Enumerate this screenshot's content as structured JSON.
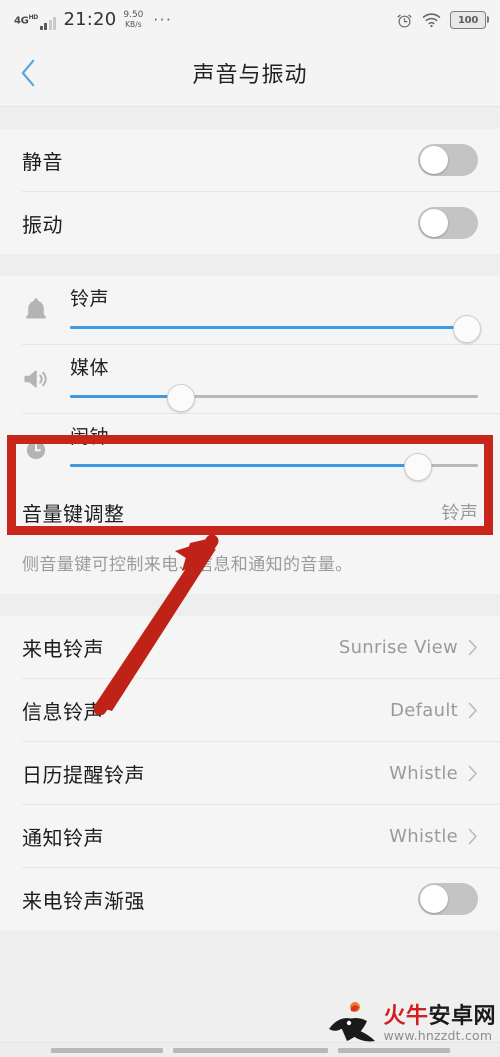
{
  "statusbar": {
    "network_label": "4G",
    "network_sup": "HD",
    "time": "21:20",
    "speed_value": "9.50",
    "speed_unit": "KB/s",
    "overflow": "···",
    "alarm_icon": "alarm-clock-icon",
    "wifi_icon": "wifi-icon",
    "battery_level": "100"
  },
  "header": {
    "back_icon": "chevron-left-icon",
    "title": "声音与振动"
  },
  "toggles": [
    {
      "label": "静音",
      "state": "off",
      "name": "mute"
    },
    {
      "label": "振动",
      "state": "off",
      "name": "vibrate"
    }
  ],
  "sliders": [
    {
      "label": "铃声",
      "icon": "bell-icon",
      "percent": 97,
      "name": "ringtone-volume"
    },
    {
      "label": "媒体",
      "icon": "speaker-icon",
      "percent": 27,
      "name": "media-volume"
    },
    {
      "label": "闹钟",
      "icon": "alarm-clock-icon",
      "percent": 85,
      "name": "alarm-volume"
    }
  ],
  "volume_key": {
    "label": "音量键调整",
    "value": "铃声",
    "description": "侧音量键可控制来电、信息和通知的音量。"
  },
  "ringtone_rows": [
    {
      "label": "来电铃声",
      "value": "Sunrise View",
      "name": "incoming-call-ringtone"
    },
    {
      "label": "信息铃声",
      "value": "Default",
      "name": "message-ringtone"
    },
    {
      "label": "日历提醒铃声",
      "value": "Whistle",
      "name": "calendar-reminder-ringtone"
    },
    {
      "label": "通知铃声",
      "value": "Whistle",
      "name": "notification-ringtone"
    }
  ],
  "last_toggle": {
    "label": "来电铃声渐强",
    "state": "off",
    "name": "rising-ringtone"
  },
  "annotation": {
    "box_name": "red-highlight-box",
    "arrow_name": "red-arrow",
    "color": "#c9261b"
  },
  "watermark": {
    "brand_red": "火牛",
    "brand_black": "安卓网",
    "url": "www.hnzzdt.com"
  },
  "navbar": {
    "recents": "recents-button",
    "home": "home-button",
    "back": "back-button"
  }
}
